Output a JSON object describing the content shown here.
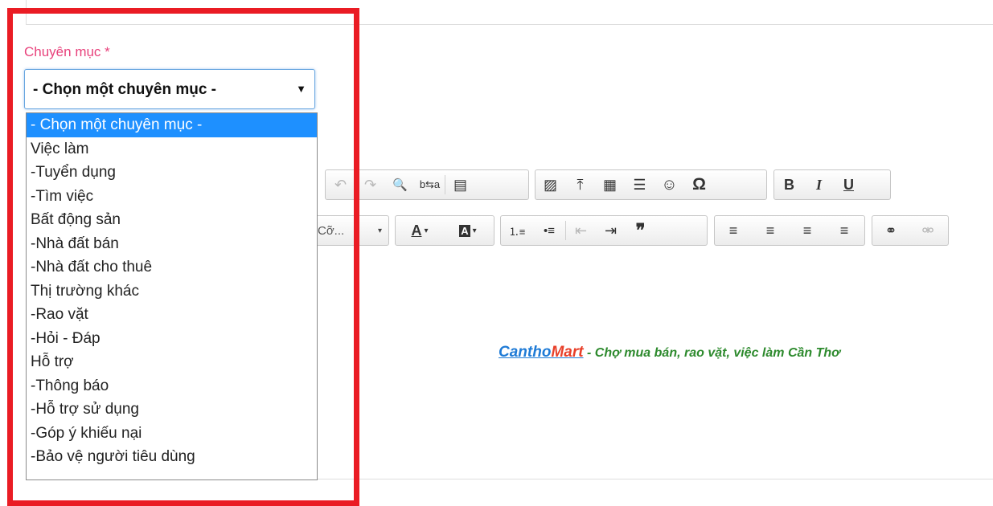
{
  "form": {
    "category_label": "Chuyên mục",
    "required_marker": "*",
    "select_value": "- Chọn một chuyên mục -",
    "select_arrow": "▼"
  },
  "dropdown": {
    "options": [
      "- Chọn một chuyên mục -",
      "Việc làm",
      "-Tuyển dụng",
      "-Tìm việc",
      "Bất động sản",
      "-Nhà đất bán",
      "-Nhà đất cho thuê",
      "Thị trường khác",
      "-Rao vặt",
      "-Hỏi - Đáp",
      "Hỗ trợ",
      "-Thông báo",
      "-Hỗ trợ sử dụng",
      "-Góp ý khiếu nại",
      "-Bảo vệ người tiêu dùng"
    ],
    "selected_index": 0
  },
  "toolbar": {
    "row1": {
      "undo": "↶",
      "redo": "↷",
      "find": "🔍",
      "replace": "b⇆a",
      "paste_text": "▤",
      "image": "▨",
      "upload": "⤒",
      "table": "▦",
      "hr": "☰",
      "smiley": "☺",
      "special_char": "Ω",
      "bold": "B",
      "italic": "I",
      "underline": "U"
    },
    "row2": {
      "font_size": "Cỡ...",
      "font_size_arrow": "▾",
      "text_color": "A",
      "text_color_arrow": "▾",
      "bg_color": "A",
      "bg_color_arrow": "▾",
      "ordered_list": "⒈≡",
      "bullet_list": "•≡",
      "outdent": "⇤",
      "indent": "⇥",
      "blockquote": "❞",
      "align_left": "≡",
      "align_center": "≡",
      "align_right": "≡",
      "align_justify": "≡",
      "link": "⚭",
      "unlink": "⚮"
    }
  },
  "content": {
    "brand_part1": "Cantho",
    "brand_part2": "Mart",
    "tagline": " - Chợ mua bán, rao vặt, việc làm Cần Thơ"
  },
  "colors": {
    "label_pink": "#e8427c",
    "highlight_frame": "#ea1c24",
    "selected_option": "#1e90ff"
  }
}
